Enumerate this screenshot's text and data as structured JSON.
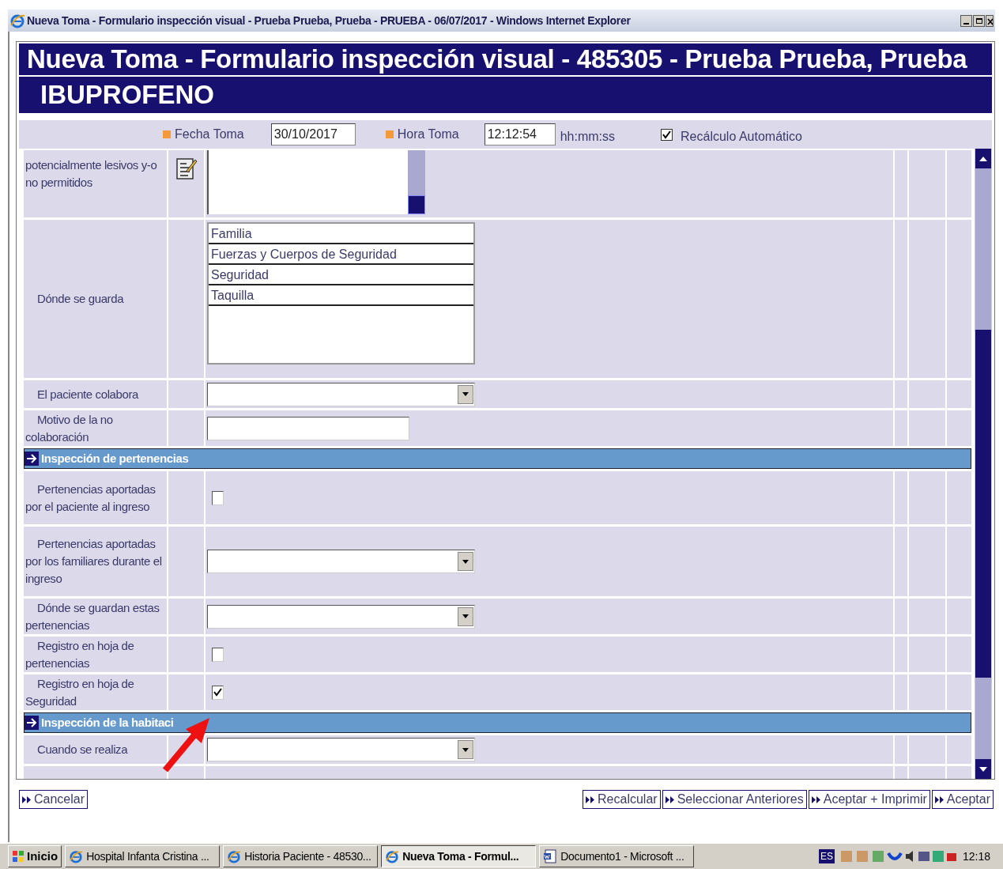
{
  "window": {
    "title": "Nueva Toma - Formulario inspección visual - Prueba Prueba, Prueba - PRUEBA - 06/07/2017 - Windows Internet Explorer"
  },
  "form": {
    "title": "Nueva Toma - Formulario inspección visual - 485305 - Prueba Prueba, Prueba",
    "subtitle": "IBUPROFENO"
  },
  "header": {
    "date_label": "Fecha Toma",
    "date_value": "30/10/2017",
    "time_label": "Hora Toma",
    "time_value": "12:12:54",
    "time_hint": "hh:mm:ss",
    "auto_label": "Recálculo Automático",
    "auto_checked": true
  },
  "rows": [
    {
      "kind": "textarea",
      "label": "potencialmente lesivos y-o no permitidos"
    },
    {
      "kind": "listbox",
      "label": "Dónde se guarda",
      "options": [
        "Familia",
        "Fuerzas y Cuerpos de Seguridad",
        "Seguridad",
        "Taquilla"
      ]
    },
    {
      "kind": "select",
      "label": "El paciente colabora"
    },
    {
      "kind": "input",
      "label": "Motivo de la no colaboración"
    },
    {
      "kind": "section",
      "label": "Inspección de pertenencias"
    },
    {
      "kind": "checkbox",
      "label": "Pertenencias aportadas por el paciente al ingreso",
      "checked": false
    },
    {
      "kind": "select",
      "label": "Pertenencias aportadas por los familiares durante el ingreso"
    },
    {
      "kind": "select",
      "label": "Dónde se guardan estas pertenencias"
    },
    {
      "kind": "checkbox",
      "label": "Registro en hoja de pertenencias",
      "checked": false
    },
    {
      "kind": "checkbox",
      "label": "Registro en hoja de Seguridad",
      "checked": true
    },
    {
      "kind": "section",
      "label": "Inspección de la habitaci"
    },
    {
      "kind": "select",
      "label": "Cuando se realiza"
    }
  ],
  "buttons_left": [
    "Cancelar"
  ],
  "buttons_right": [
    "Recalcular",
    "Seleccionar Anteriores",
    "Aceptar + Imprimir",
    "Aceptar"
  ],
  "taskbar": {
    "start": "Inicio",
    "tasks": [
      {
        "label": "Hospital Infanta Cristina ...",
        "selected": false,
        "kind": "browser"
      },
      {
        "label": "Historia Paciente - 48530...",
        "selected": false,
        "kind": "browser"
      },
      {
        "label": "Nueva Toma - Formul...",
        "selected": true,
        "kind": "browser"
      },
      {
        "label": "Documento1 - Microsoft ...",
        "selected": false,
        "kind": "document"
      }
    ],
    "language": "ES",
    "clock": "12:18"
  }
}
